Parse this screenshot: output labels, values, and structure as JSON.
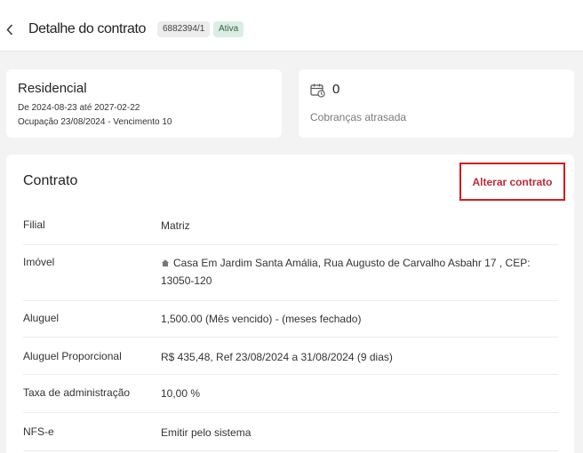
{
  "header": {
    "title": "Detalhe do contrato",
    "contract_id": "6882394/1",
    "status": "Ativa"
  },
  "plan_card": {
    "name": "Residencial",
    "period": "De 2024-08-23 até 2027-02-22",
    "occupation": "Ocupação 23/08/2024 - Vencimento 10"
  },
  "overdue_card": {
    "count": "0",
    "label": "Cobranças atrasada",
    "icon": "calendar-icon"
  },
  "contract": {
    "title": "Contrato",
    "change_label": "Alterar contrato",
    "rows": [
      {
        "label": "Filial",
        "value": "Matriz"
      },
      {
        "label": "Imóvel",
        "value": "Casa Em Jardim Santa Amália, Rua Augusto de Carvalho Asbahr 17 , CEP: 13050-120"
      },
      {
        "label": "Aluguel",
        "value": "1,500.00 (Mês vencido) - (meses fechado)"
      },
      {
        "label": "Aluguel Proporcional",
        "value": "R$ 435,48, Ref 23/08/2024 a 31/08/2024 (9 dias)"
      },
      {
        "label": "Taxa de administração",
        "value": "10,00 %"
      },
      {
        "label": "NFS-e",
        "value": "Emitir pelo sistema"
      }
    ]
  },
  "colors": {
    "accent_red": "#c0283a",
    "highlight_border": "#d61a1a",
    "status_bg": "#dbeee4"
  }
}
